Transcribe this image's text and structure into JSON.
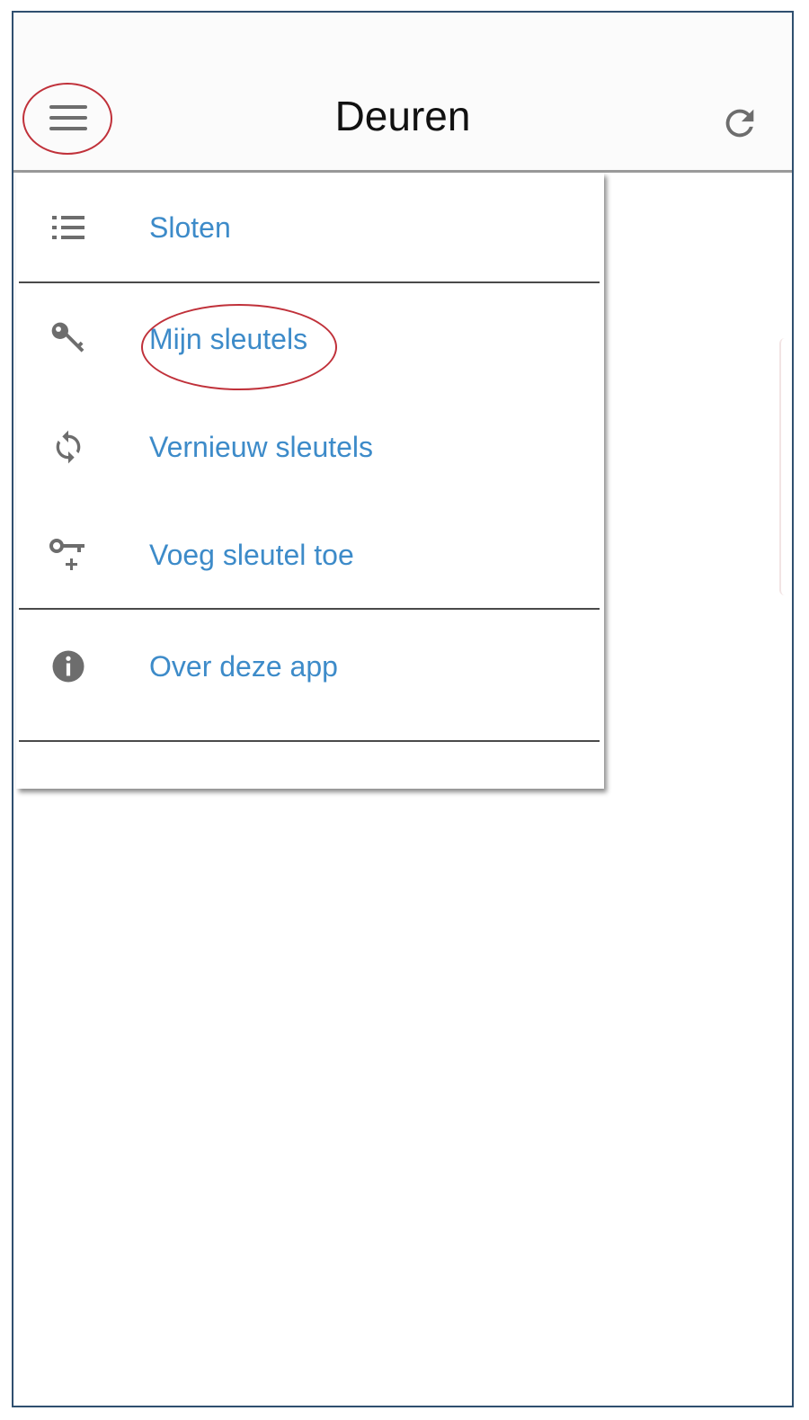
{
  "appbar": {
    "title": "Deuren",
    "menu_icon": "hamburger-menu-icon",
    "refresh_icon": "refresh-icon"
  },
  "drawer": {
    "items": [
      {
        "label": "Sloten",
        "icon": "list-icon"
      },
      {
        "label": "Mijn sleutels",
        "icon": "key-icon"
      },
      {
        "label": "Vernieuw sleutels",
        "icon": "sync-icon"
      },
      {
        "label": "Voeg sleutel toe",
        "icon": "add-key-icon"
      },
      {
        "label": "Over deze app",
        "icon": "info-icon"
      }
    ]
  },
  "colors": {
    "link_text": "#3d8bc9",
    "annotation_ring": "#c0313a",
    "icon_gray": "#6d6d6d",
    "frame_border": "#2f4f6f"
  }
}
